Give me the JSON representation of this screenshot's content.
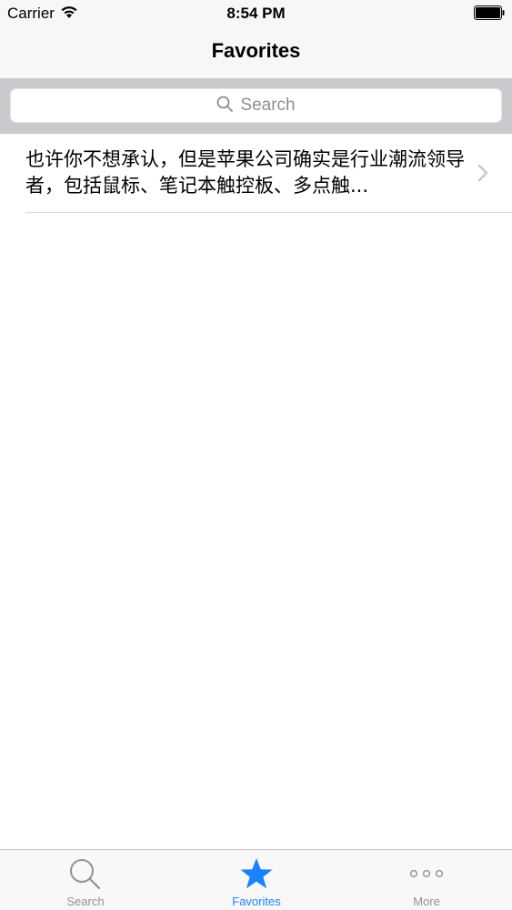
{
  "status_bar": {
    "carrier": "Carrier",
    "time": "8:54 PM"
  },
  "nav": {
    "title": "Favorites"
  },
  "search": {
    "placeholder": "Search",
    "icon": "search-icon"
  },
  "list": {
    "items": [
      {
        "text": "也许你不想承认，但是苹果公司确实是行业潮流领导者，包括鼠标、笔记本触控板、多点触...",
        "icon": "chevron-right-icon"
      }
    ]
  },
  "tabbar": {
    "tabs": [
      {
        "label": "Search",
        "icon": "magnifier-icon",
        "selected": false
      },
      {
        "label": "Favorites",
        "icon": "star-icon",
        "selected": true
      },
      {
        "label": "More",
        "icon": "ellipsis-icon",
        "selected": false
      }
    ]
  },
  "colors": {
    "accent": "#1a82fb",
    "inactive": "#929292",
    "search_bar_bg": "#c9c9ce",
    "nav_bg": "#f7f7f7"
  }
}
